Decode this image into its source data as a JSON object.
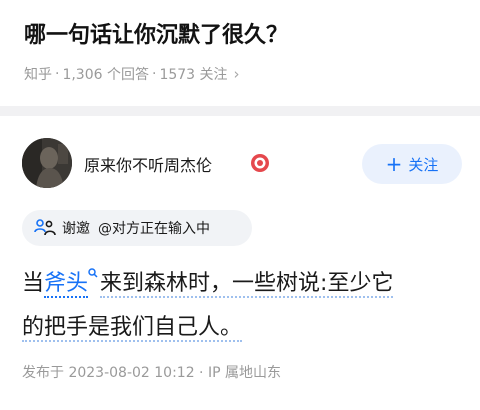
{
  "question": {
    "title": "哪一句话让你沉默了很久？",
    "meta": {
      "site": "知乎",
      "answers": "1,306 个回答",
      "followers": "1573 关注",
      "separator": "·",
      "chevron": "›"
    }
  },
  "author": {
    "name": "原来你不听周杰伦",
    "badge_icon": "creator-badge-icon",
    "follow_icon": "+",
    "follow_label": "关注"
  },
  "invite": {
    "icon": "invite-people-icon",
    "label": "谢邀",
    "status": "@对方正在输入中"
  },
  "answer": {
    "before_keyword": "当",
    "keyword": "斧头",
    "line1_rest": "来到森林时，一些树说:至少它",
    "line2": "的把手是我们自己人。"
  },
  "publish": {
    "text": "发布于 2023-08-02 10:12 · IP 属地山东"
  },
  "colors": {
    "accent": "#1772f6",
    "follow_bg": "#eaf1fd",
    "muted": "#9a9a9a",
    "badge": "#e5484d"
  }
}
